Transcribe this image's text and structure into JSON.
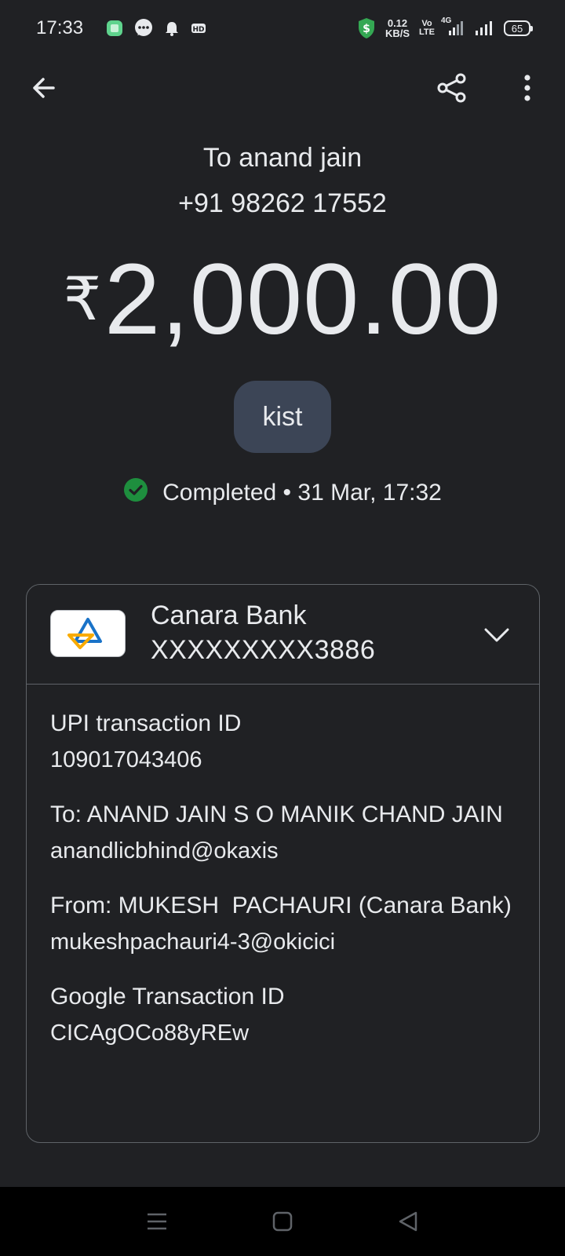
{
  "status_bar": {
    "time": "17:33",
    "net_speed_value": "0.12",
    "net_speed_unit": "KB/S",
    "volte_top": "Vo",
    "volte_bottom": "LTE",
    "network_type": "4G",
    "battery": "65",
    "icons": [
      "app-icon",
      "message-icon",
      "bell-icon",
      "hd-icon",
      "vpn-shield-icon",
      "signal-icon",
      "signal-icon",
      "battery-icon"
    ]
  },
  "app_bar": {
    "icons": [
      "back-arrow-icon",
      "share-icon",
      "more-vert-icon"
    ]
  },
  "payment": {
    "recipient_name": "To anand jain",
    "recipient_phone": "+91 98262 17552",
    "currency_symbol": "₹",
    "amount": "2,000.00",
    "note": "kist",
    "status": "Completed • 31 Mar, 17:32",
    "status_color": "#1e8e3e"
  },
  "bank": {
    "name": "Canara Bank",
    "account": "XXXXXXXXX3886"
  },
  "details": {
    "upi_label": "UPI transaction ID",
    "upi_value": "109017043406",
    "to_label": "To: ANAND JAIN S O MANIK CHAND JAIN",
    "to_value": "anandlicbhind@okaxis",
    "from_label": "From: MUKESH  PACHAURI (Canara Bank)",
    "from_value": "mukeshpachauri4-3@okicici",
    "google_label": "Google Transaction ID",
    "google_value": "CICAgOCo88yREw"
  },
  "nav_bar": {
    "icons": [
      "menu-icon",
      "home-icon",
      "back-triangle-icon"
    ]
  },
  "colors": {
    "background": "#202124",
    "chip": "#3c4556",
    "border": "#5f6368"
  }
}
